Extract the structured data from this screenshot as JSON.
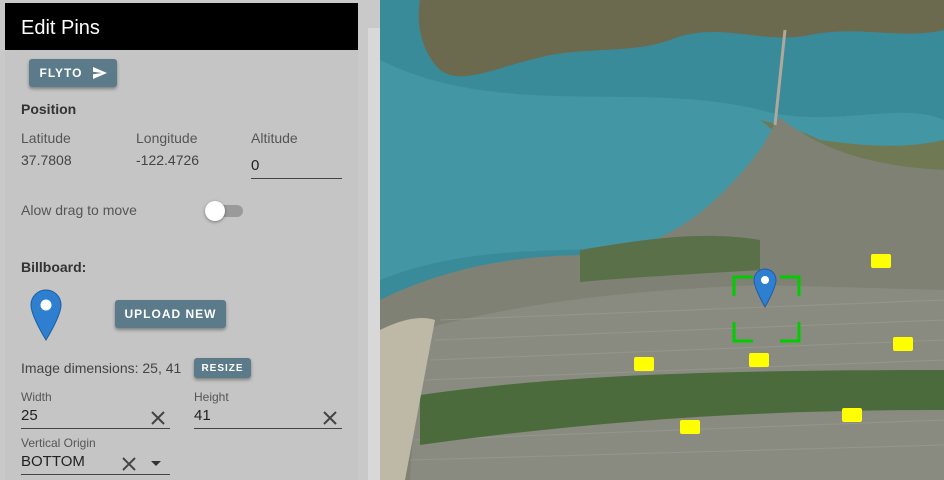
{
  "panel": {
    "title": "Edit Pins",
    "flyto_label": "FLYTO",
    "position": {
      "heading": "Position",
      "latitude_label": "Latitude",
      "latitude_value": "37.7808",
      "longitude_label": "Longitude",
      "longitude_value": "-122.4726",
      "altitude_label": "Altitude",
      "altitude_value": "0"
    },
    "drag_toggle_label": "Alow drag to move",
    "drag_toggle_on": false,
    "billboard": {
      "heading": "Billboard:",
      "upload_label": "UPLOAD NEW",
      "dimensions_text": "Image dimensions: 25, 41",
      "resize_label": "RESIZE",
      "width_label": "Width",
      "width_value": "25",
      "height_label": "Height",
      "height_value": "41",
      "vertical_origin_label": "Vertical Origin",
      "vertical_origin_value": "BOTTOM"
    }
  },
  "colors": {
    "header_bg": "#000000",
    "button_bg": "#5b7b8b",
    "pin_blue": "#2e7fd0",
    "marker_yellow": "#ffff00",
    "selection_green": "#00cc00"
  },
  "map": {
    "selected_pin_icon": "map-pin-icon",
    "billboard_markers": 6
  }
}
